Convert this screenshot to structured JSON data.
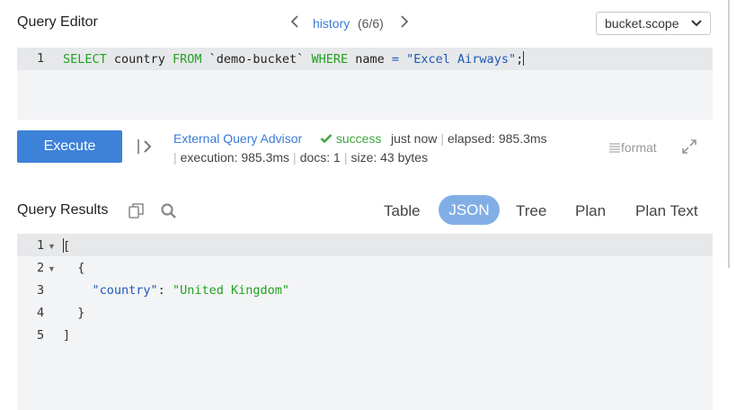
{
  "editor_header": {
    "title": "Query Editor",
    "history_link": "history",
    "history_count": "(6/6)",
    "scope_select": "bucket.scope"
  },
  "editor": {
    "line_number": "1",
    "query": {
      "kw_select": "SELECT",
      "field": "country",
      "kw_from": "FROM",
      "bucket": "`demo-bucket`",
      "kw_where": "WHERE",
      "cond_field": "name",
      "op": "=",
      "value": "\"Excel Airways\"",
      "term": ";"
    }
  },
  "exec_bar": {
    "execute_label": "Execute",
    "advisor_link": "External Query Advisor",
    "status": "success",
    "when": "just now",
    "elapsed": "elapsed: 985.3ms",
    "execution": "execution: 985.3ms",
    "docs": "docs: 1",
    "size": "size: 43 bytes",
    "format_label": "format"
  },
  "results_header": {
    "title": "Query Results",
    "tabs": [
      "Table",
      "JSON",
      "Tree",
      "Plan",
      "Plan Text"
    ],
    "active_tab": "JSON"
  },
  "results": {
    "lines": [
      {
        "n": "1",
        "text": "["
      },
      {
        "n": "2",
        "text": "  {"
      },
      {
        "n": "3",
        "key": "\"country\"",
        "colon": ": ",
        "val": "\"United Kingdom\""
      },
      {
        "n": "4",
        "text": "  }"
      },
      {
        "n": "5",
        "text": "]"
      }
    ]
  },
  "colors": {
    "accent": "#3d82d9",
    "keyword": "#22a122",
    "string": "#1d58b8",
    "success": "#3ea63e"
  }
}
